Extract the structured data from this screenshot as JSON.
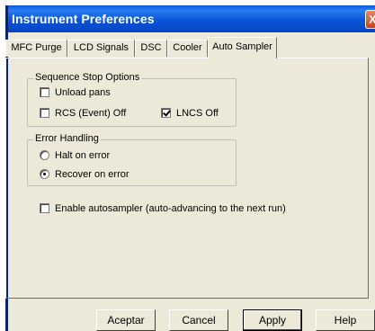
{
  "window": {
    "title": "Instrument Preferences",
    "close_glyph": "X"
  },
  "tabs": [
    {
      "label": "MFC Purge"
    },
    {
      "label": "LCD Signals"
    },
    {
      "label": "DSC"
    },
    {
      "label": "Cooler"
    },
    {
      "label": "Auto Sampler",
      "active": true
    }
  ],
  "sequence_stop": {
    "legend": "Sequence Stop Options",
    "unload_pans": {
      "label": "Unload pans",
      "checked": false
    },
    "rcs_off": {
      "label": "RCS (Event) Off",
      "checked": false
    },
    "lncs_off": {
      "label": "LNCS Off",
      "checked": true
    }
  },
  "error_handling": {
    "legend": "Error Handling",
    "halt": {
      "label": "Halt on error",
      "selected": false
    },
    "recover": {
      "label": "Recover on error",
      "selected": true
    }
  },
  "autosampler": {
    "label": "Enable autosampler (auto-advancing to the next run)",
    "checked": false
  },
  "buttons": {
    "ok": "Aceptar",
    "cancel": "Cancel",
    "apply": "Apply",
    "help": "Help"
  }
}
